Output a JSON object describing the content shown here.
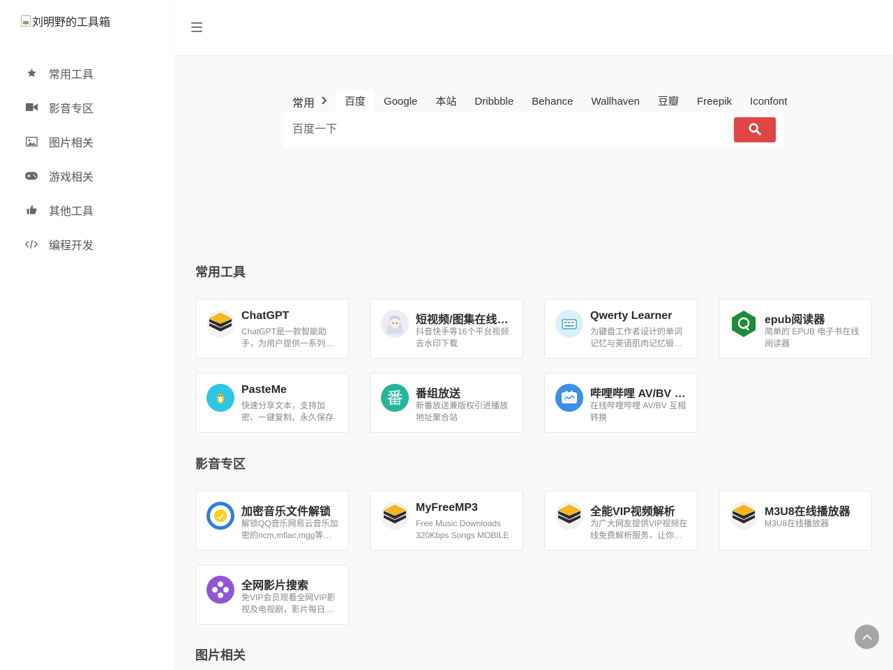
{
  "site": {
    "logo_alt": "刘明野的工具箱"
  },
  "sidebar": {
    "items": [
      {
        "label": "常用工具",
        "icon": "star-icon"
      },
      {
        "label": "影音专区",
        "icon": "video-camera-icon"
      },
      {
        "label": "图片相关",
        "icon": "image-icon"
      },
      {
        "label": "游戏相关",
        "icon": "gamepad-icon"
      },
      {
        "label": "其他工具",
        "icon": "thumbs-up-icon"
      },
      {
        "label": "编程开发",
        "icon": "code-icon"
      }
    ]
  },
  "search": {
    "group_label": "常用",
    "tabs": [
      "百度",
      "Google",
      "本站",
      "Dribbble",
      "Behance",
      "Wallhaven",
      "豆瓣",
      "Freepik",
      "Iconfont"
    ],
    "active_tab": "百度",
    "placeholder": "百度一下",
    "accent_color": "#e04545"
  },
  "sections": [
    {
      "title": "常用工具",
      "cards": [
        {
          "title": "ChatGPT",
          "desc": "ChatGPT是一款智能助手，为用户提供一系列服务",
          "icon": "layers-icon"
        },
        {
          "title": "短视频/图集在线解析",
          "desc": "抖音快手等16个平台视频去水印下载",
          "icon": "anime-avatar-icon"
        },
        {
          "title": "Qwerty Learner",
          "desc": "为键盘工作者设计的单词记忆与英语肌肉记忆锻炼软件",
          "icon": "keyboard-icon"
        },
        {
          "title": "epub阅读器",
          "desc": "简单的 EPUB 电子书在线阅读器",
          "icon": "q-hexagon-icon"
        },
        {
          "title": "PasteMe",
          "desc": "快速分享文本，支持加密、一键复制、永久保存",
          "icon": "penguin-icon"
        },
        {
          "title": "番组放送",
          "desc": "新番放送兼版权引进播放地址聚合站",
          "icon": "fan-character-icon"
        },
        {
          "title": "哔哩哔哩 AV/BV 互相转换",
          "desc": "在线哔哩哔哩 AV/BV 互相转换",
          "icon": "tv-icon"
        }
      ]
    },
    {
      "title": "影音专区",
      "cards": [
        {
          "title": "加密音乐文件解锁",
          "desc": "解锁QQ音乐网易云音乐加密的ncm,mflac,mgg等格式",
          "icon": "music-disc-icon"
        },
        {
          "title": "MyFreeMP3",
          "desc": "Free Music Downloads 320Kbps Songs MOBILE",
          "icon": "layers-icon"
        },
        {
          "title": "全能VIP视频解析",
          "desc": "为广大网友提供VIP视频在线免费解析服务，让你轻松观影",
          "icon": "layers-icon"
        },
        {
          "title": "M3U8在线播放器",
          "desc": "M3U8在线播放器",
          "icon": "layers-icon"
        },
        {
          "title": "全网影片搜索",
          "desc": "免VIP会员观看全网VIP影视及电视剧，影片每日更新",
          "icon": "film-reel-icon"
        }
      ]
    },
    {
      "title": "图片相关",
      "cards": []
    }
  ],
  "back_to_top": {
    "icon": "chevron-up-icon"
  }
}
